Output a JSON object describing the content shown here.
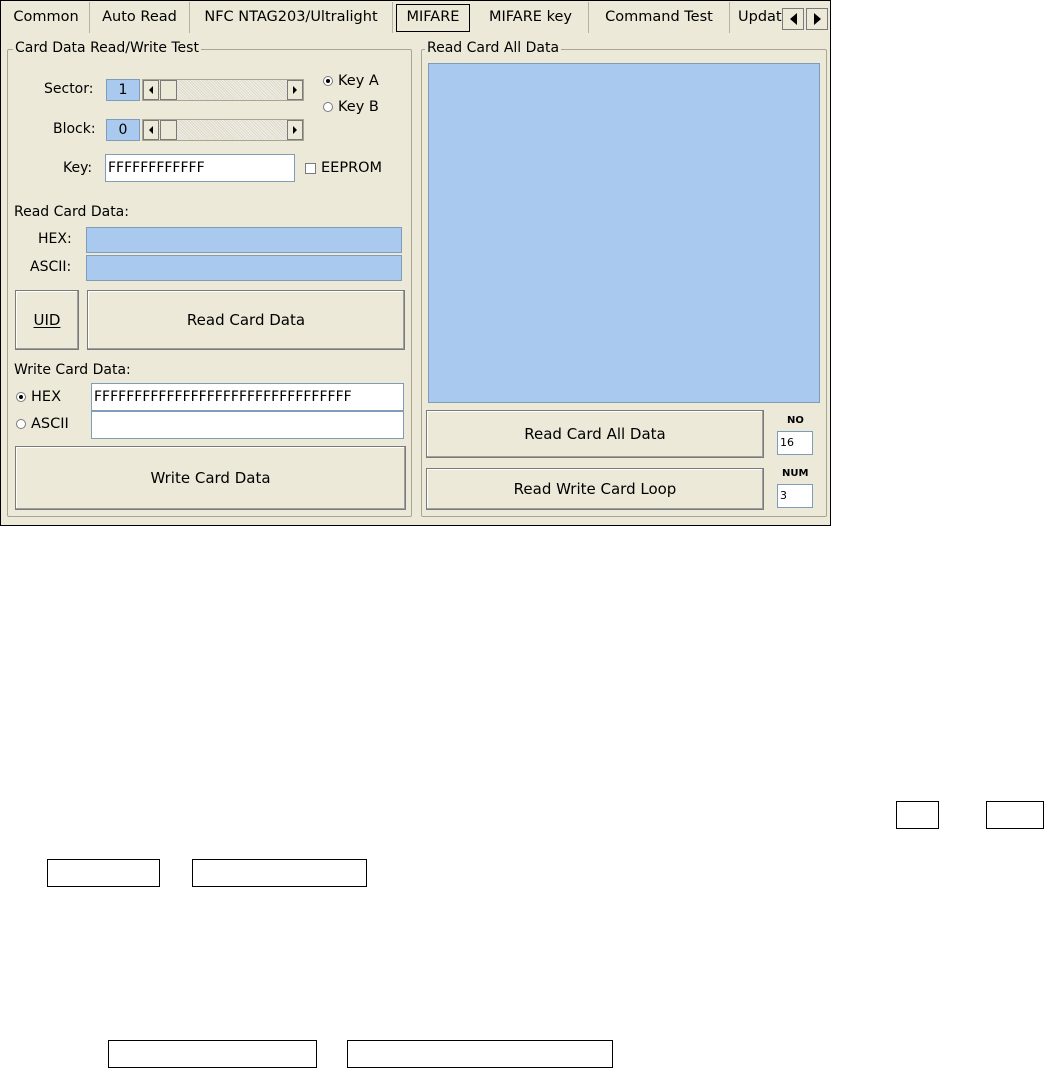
{
  "tabs": [
    "Common",
    "Auto Read",
    "NFC NTAG203/Ultralight",
    "MIFARE",
    "MIFARE key",
    "Command Test",
    "Updat"
  ],
  "active_tab": "MIFARE",
  "card_rw": {
    "group_title": "Card Data Read/Write Test",
    "sector_label": "Sector:",
    "sector_value": "1",
    "block_label": "Block:",
    "block_value": "0",
    "key_a_label": "Key A",
    "key_b_label": "Key B",
    "key_label": "Key:",
    "key_value": "FFFFFFFFFFFF",
    "eeprom_label": "EEPROM",
    "read_section_label": "Read Card Data:",
    "hex_label": "HEX:",
    "ascii_label": "ASCII:",
    "uid_button": "UID",
    "read_button": "Read Card Data",
    "write_section_label": "Write Card Data:",
    "write_hex_label": "HEX",
    "write_ascii_label": "ASCII",
    "write_hex_value": "FFFFFFFFFFFFFFFFFFFFFFFFFFFFFFFF",
    "write_ascii_value": "",
    "write_button": "Write Card Data"
  },
  "read_all": {
    "group_title": "Read Card All Data",
    "read_all_button": "Read Card All Data",
    "loop_button": "Read Write Card Loop",
    "no_label": "NO",
    "no_value": "16",
    "num_label": "NUM",
    "num_value": "3"
  },
  "colors": {
    "window_bg": "#ECE9D8",
    "field_blue": "#A9C9EE"
  },
  "icons": [
    "tab-scroll-left-icon",
    "tab-scroll-right-icon",
    "scroll-left-arrow-icon",
    "scroll-right-arrow-icon"
  ]
}
